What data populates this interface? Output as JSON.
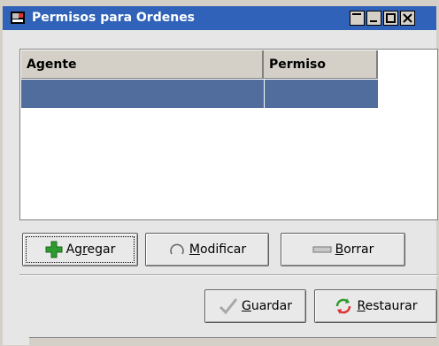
{
  "window": {
    "title": "Permisos para Ordenes",
    "controls": [
      "restore-icon",
      "minimize-icon",
      "maximize-icon",
      "close-icon"
    ]
  },
  "table": {
    "columns": [
      "Agente",
      "Permiso"
    ],
    "rows": [
      [
        "",
        ""
      ]
    ],
    "selected_row_color": "#516d9d"
  },
  "actions": {
    "add": {
      "pre": "Ag",
      "mn": "r",
      "post": "egar",
      "icon": "plus-icon"
    },
    "modify": {
      "pre": "",
      "mn": "M",
      "post": "odificar",
      "icon": "refresh-icon"
    },
    "delete": {
      "pre": "",
      "mn": "B",
      "post": "orrar",
      "icon": "minus-icon"
    }
  },
  "footer": {
    "save": {
      "pre": "",
      "mn": "G",
      "post": "uardar",
      "icon": "check-icon"
    },
    "restore": {
      "pre": "",
      "mn": "R",
      "post": "estaurar",
      "icon": "restore-arrows-icon"
    }
  },
  "colors": {
    "titlebar": "#2f62b8",
    "accent_green": "#2e9b2e"
  }
}
